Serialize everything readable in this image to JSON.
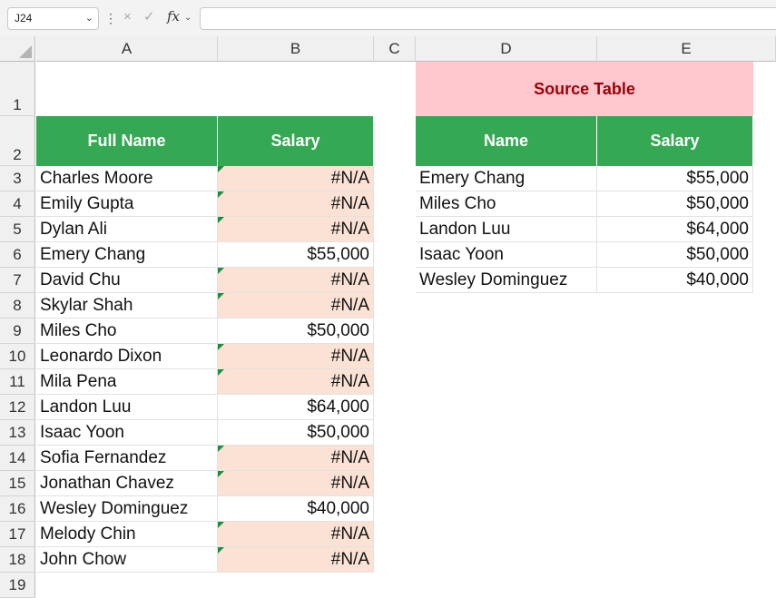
{
  "formula_bar": {
    "name_box": "J24",
    "name_box_chevron": "chevron-down-icon",
    "more_icon": "more-vertical-icon",
    "cancel_icon": "×",
    "enter_icon": "✓",
    "fx_label": "fx",
    "formula": ""
  },
  "columns": [
    "A",
    "B",
    "C",
    "D",
    "E"
  ],
  "rows": [
    "1",
    "2",
    "3",
    "4",
    "5",
    "6",
    "7",
    "8",
    "9",
    "10",
    "11",
    "12",
    "13",
    "14",
    "15",
    "16",
    "17",
    "18",
    "19"
  ],
  "main_table": {
    "headers": [
      "Full Name",
      "Salary"
    ],
    "rows": [
      {
        "name": "Charles Moore",
        "salary": "#N/A"
      },
      {
        "name": "Emily Gupta",
        "salary": "#N/A"
      },
      {
        "name": "Dylan Ali",
        "salary": "#N/A"
      },
      {
        "name": "Emery Chang",
        "salary": "$55,000"
      },
      {
        "name": "David Chu",
        "salary": "#N/A"
      },
      {
        "name": "Skylar Shah",
        "salary": "#N/A"
      },
      {
        "name": "Miles Cho",
        "salary": "$50,000"
      },
      {
        "name": "Leonardo Dixon",
        "salary": "#N/A"
      },
      {
        "name": "Mila Pena",
        "salary": "#N/A"
      },
      {
        "name": "Landon Luu",
        "salary": "$64,000"
      },
      {
        "name": "Isaac Yoon",
        "salary": "$50,000"
      },
      {
        "name": "Sofia Fernandez",
        "salary": "#N/A"
      },
      {
        "name": "Jonathan Chavez",
        "salary": "#N/A"
      },
      {
        "name": "Wesley Dominguez",
        "salary": "$40,000"
      },
      {
        "name": "Melody Chin",
        "salary": "#N/A"
      },
      {
        "name": "John Chow",
        "salary": "#N/A"
      }
    ]
  },
  "source_table": {
    "title": "Source Table",
    "headers": [
      "Name",
      "Salary"
    ],
    "rows": [
      {
        "name": "Emery Chang",
        "salary": "$55,000"
      },
      {
        "name": "Miles Cho",
        "salary": "$50,000"
      },
      {
        "name": "Landon Luu",
        "salary": "$64,000"
      },
      {
        "name": "Isaac Yoon",
        "salary": "$50,000"
      },
      {
        "name": "Wesley Dominguez",
        "salary": "$40,000"
      }
    ]
  },
  "colors": {
    "header_green": "#34a853",
    "error_fill": "#fbe2d5",
    "title_fill": "#ffc7ce",
    "title_text": "#9c0006",
    "error_marker": "#1e8e3e"
  }
}
